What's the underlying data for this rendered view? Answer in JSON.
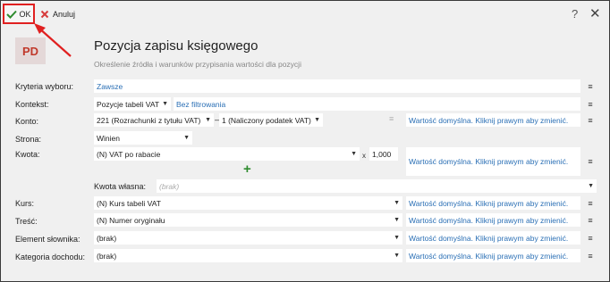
{
  "toolbar": {
    "ok_label": "OK",
    "cancel_label": "Anuluj",
    "help_label": "?",
    "close_label": "✕"
  },
  "header": {
    "icon_text": "PD",
    "title": "Pozycja zapisu księgowego",
    "subtitle": "Określenie źródła i warunków przypisania wartości dla pozycji"
  },
  "colors": {
    "ok_check": "#2e8b2e",
    "cancel_x": "#d63a3a",
    "highlight": "#e02020",
    "link": "#2a6fb5",
    "icon_bg": "#e4d8d8",
    "icon_fg": "#c0392b"
  },
  "form": {
    "kryteria": {
      "label": "Kryteria wyboru:",
      "value": "Zawsze"
    },
    "kontekst": {
      "label": "Kontekst:",
      "value": "Pozycje tabeli VAT",
      "filter": "Bez filtrowania"
    },
    "konto": {
      "label": "Konto:",
      "value1": "221 (Rozrachunki z tytułu VAT)",
      "separator": "–",
      "value2": "1 (Naliczony podatek VAT)",
      "default_text": "Wartość domyślna. Kliknij prawym aby zmienić."
    },
    "strona": {
      "label": "Strona:",
      "value": "Winien"
    },
    "kwota": {
      "label": "Kwota:",
      "value": "(N) VAT po rabacie",
      "multiplier_sign": "x",
      "multiplier": "1,000",
      "default_text": "Wartość domyślna. Kliknij prawym aby zmienić."
    },
    "kwota_wlasna": {
      "label": "Kwota własna:",
      "placeholder": "(brak)"
    },
    "kurs": {
      "label": "Kurs:",
      "value": "(N) Kurs tabeli VAT",
      "default_text": "Wartość domyślna. Kliknij prawym aby zmienić."
    },
    "tresc": {
      "label": "Treść:",
      "value": "(N) Numer oryginału",
      "default_text": "Wartość domyślna. Kliknij prawym aby zmienić."
    },
    "element": {
      "label": "Element słownika:",
      "value": "(brak)",
      "default_text": "Wartość domyślna. Kliknij prawym aby zmienić."
    },
    "kategoria": {
      "label": "Kategoria dochodu:",
      "value": "(brak)",
      "default_text": "Wartość domyślna. Kliknij prawym aby zmienić."
    }
  }
}
